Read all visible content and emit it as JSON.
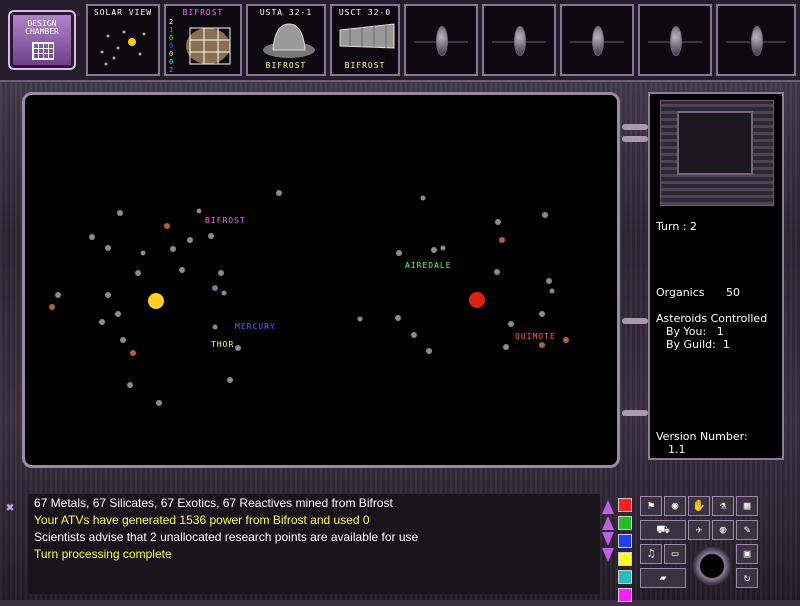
{
  "top": {
    "design_chamber": "DESIGN CHAMBER",
    "solar_view": "SOLAR VIEW",
    "bifrost_tab": "BIFROST",
    "usta_label": "USTA 32-1",
    "usta_sub": "BIFROST",
    "usct_label": "USCT 32-0",
    "usct_sub": "BIFROST",
    "bifrost_numbers": [
      "2",
      "1",
      "0",
      "0",
      "0",
      "0",
      "2"
    ]
  },
  "map_labels": [
    {
      "text": "BIFROST",
      "color": "#ff60ff"
    },
    {
      "text": "AIREDALE",
      "color": "#60ff60"
    },
    {
      "text": "MERCURY",
      "color": "#6060ff"
    },
    {
      "text": "THOR",
      "color": "#ffff60"
    },
    {
      "text": "QUIMOTE",
      "color": "#ff6060"
    }
  ],
  "side": {
    "turn": "Turn : 2",
    "organics_label": "Organics",
    "organics_value": "50",
    "asteroids_title": "Asteroids Controlled",
    "by_you": "By You:   1",
    "by_guild": "By Guild:  1",
    "version_label": "Version Number:",
    "version_value": "1.1"
  },
  "messages": [
    {
      "text": "67 Metals, 67 Silicates, 67 Exotics, 67 Reactives mined from Bifrost",
      "color": "white"
    },
    {
      "text": "Your ATVs have generated 1536 power from Bifrost and used 0",
      "color": "yellow"
    },
    {
      "text": "Scientists advise that 2 unallocated research points are available for use",
      "color": "white"
    },
    {
      "text": "Turn processing complete",
      "color": "yellow"
    }
  ],
  "colors": [
    "#ff2020",
    "#20c020",
    "#2040ff",
    "#ffff20",
    "#20c0c0",
    "#ff20ff"
  ],
  "icons": [
    "close-icon",
    "scroll-up-icon",
    "scroll-down-icon",
    "dial-icon"
  ]
}
